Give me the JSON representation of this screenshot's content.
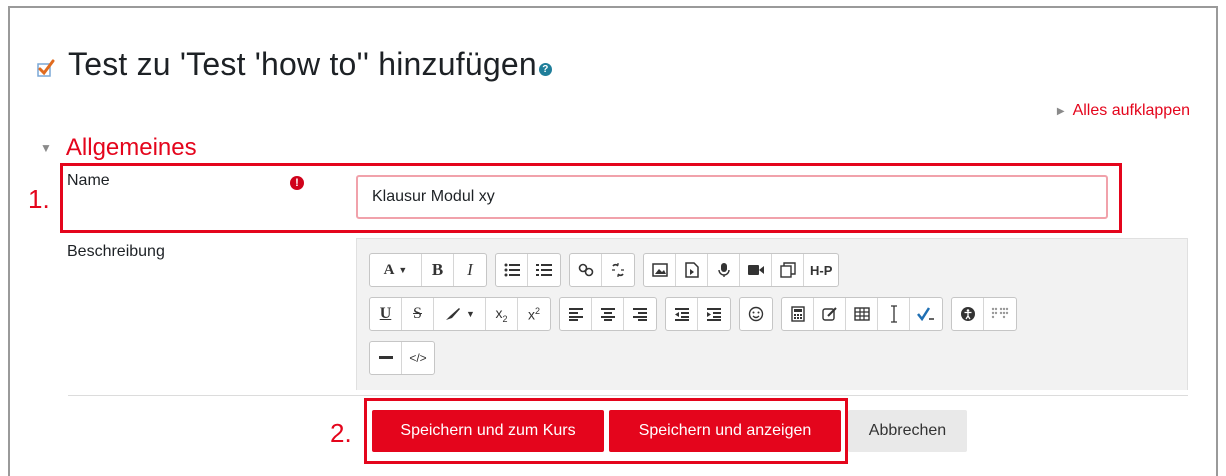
{
  "page": {
    "title": "Test zu 'Test 'how to'' hinzufügen",
    "title_icon": "quiz-checkbox-icon",
    "help_icon": "help-icon",
    "expand_all_label": "Alles aufklappen"
  },
  "section": {
    "title": "Allgemeines"
  },
  "annotations": {
    "step1": "1.",
    "step2": "2."
  },
  "form": {
    "name_label": "Name",
    "name_value": "Klausur Modul xy",
    "required_icon": "exclamation-circle-icon",
    "description_label": "Beschreibung"
  },
  "editor_toolbar": {
    "row1": [
      [
        "font-size-dropdown-icon",
        "bold-icon",
        "italic-icon"
      ],
      [
        "unordered-list-icon",
        "ordered-list-icon"
      ],
      [
        "link-icon",
        "unlink-icon"
      ],
      [
        "image-icon",
        "media-icon",
        "record-audio-icon",
        "record-video-icon",
        "manage-files-icon",
        "h5p-icon"
      ]
    ],
    "row2": [
      [
        "underline-icon",
        "strikethrough-icon",
        "text-color-dropdown-icon",
        "subscript-icon",
        "superscript-icon"
      ],
      [
        "align-left-icon",
        "align-center-icon",
        "align-right-icon"
      ],
      [
        "outdent-icon",
        "indent-icon"
      ],
      [
        "emoticon-icon"
      ],
      [
        "equation-icon",
        "edit-icon",
        "table-icon",
        "special-char-icon",
        "spellcheck-icon"
      ],
      [
        "accessibility-checker-icon",
        "screenreader-helper-icon"
      ]
    ],
    "row3": [
      [
        "horizontal-rule-icon",
        "html-icon"
      ]
    ]
  },
  "buttons": {
    "save_return": "Speichern und zum Kurs",
    "save_display": "Speichern und anzeigen",
    "cancel": "Abbrechen"
  },
  "colors": {
    "accent": "#e4051c",
    "annotation": "#e4051c",
    "secondary_button": "#e9e9e9"
  }
}
